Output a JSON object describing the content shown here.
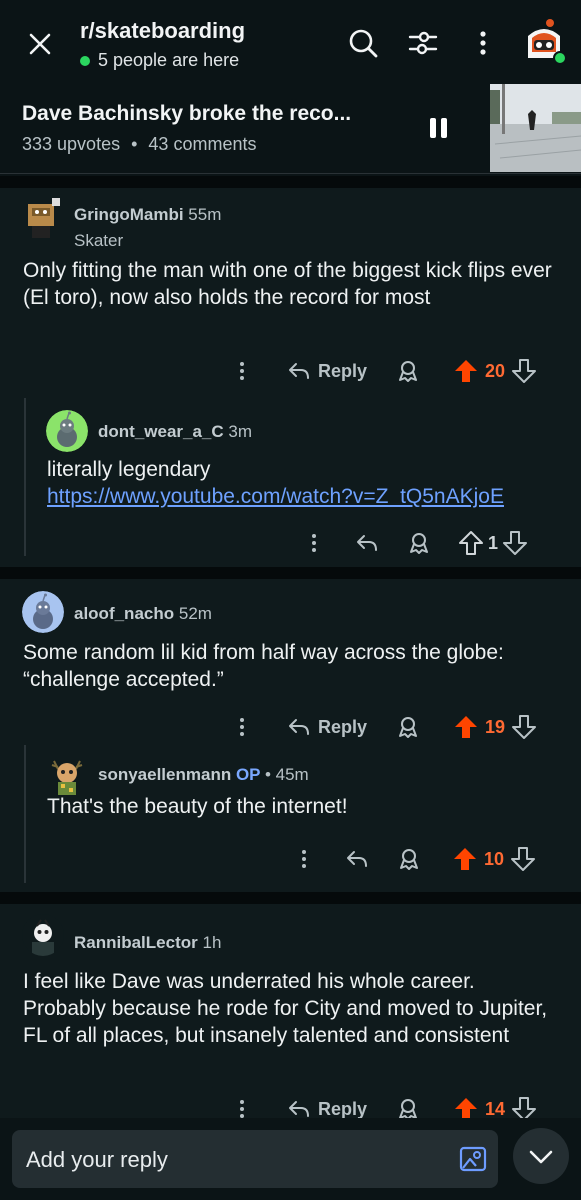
{
  "header": {
    "subreddit": "r/skateboarding",
    "online": "5 people are here"
  },
  "post": {
    "title": "Dave Bachinsky broke the reco...",
    "upvotes": "333 upvotes",
    "separator": "•",
    "comments": "43 comments"
  },
  "comments": [
    {
      "username": "GringoMambi",
      "time": "55m",
      "flair": "Skater",
      "text": "Only fitting the man with one of the biggest kick flips ever (El toro), now also holds the record for most",
      "reply_label": "Reply",
      "votes": "20",
      "replies": [
        {
          "username": "dont_wear_a_C",
          "time": "3m",
          "text": "literally legendary",
          "link": "https://www.youtube.com/watch?v=Z_tQ5nAKjoE",
          "votes": "1"
        }
      ]
    },
    {
      "username": "aloof_nacho",
      "time": "52m",
      "text": "Some random lil kid from half way across the globe: “challenge accepted.”",
      "reply_label": "Reply",
      "votes": "19",
      "replies": [
        {
          "username": "sonyaellenmann",
          "op": "OP",
          "dot": "•",
          "time": "45m",
          "text": "That's the beauty of the internet!",
          "votes": "10"
        }
      ]
    },
    {
      "username": "RannibalLector",
      "time": "1h",
      "text": "I feel like Dave was underrated his whole career. Probably because he rode for City and moved to Jupiter, FL of all places, but insanely talented and consistent",
      "reply_label": "Reply",
      "votes": "14"
    }
  ],
  "reply_bar": {
    "placeholder": "Add your reply"
  },
  "colors": {
    "upvote_active": "#ff4500",
    "count_active": "#ff6a33",
    "link": "#6ea1ff",
    "online": "#2bd65f"
  },
  "icons": [
    "close-icon",
    "search-icon",
    "filter-icon",
    "more-vertical-icon",
    "award-icon",
    "reply-arrow-icon",
    "upvote-icon",
    "downvote-icon",
    "image-icon",
    "chevron-down-icon"
  ]
}
